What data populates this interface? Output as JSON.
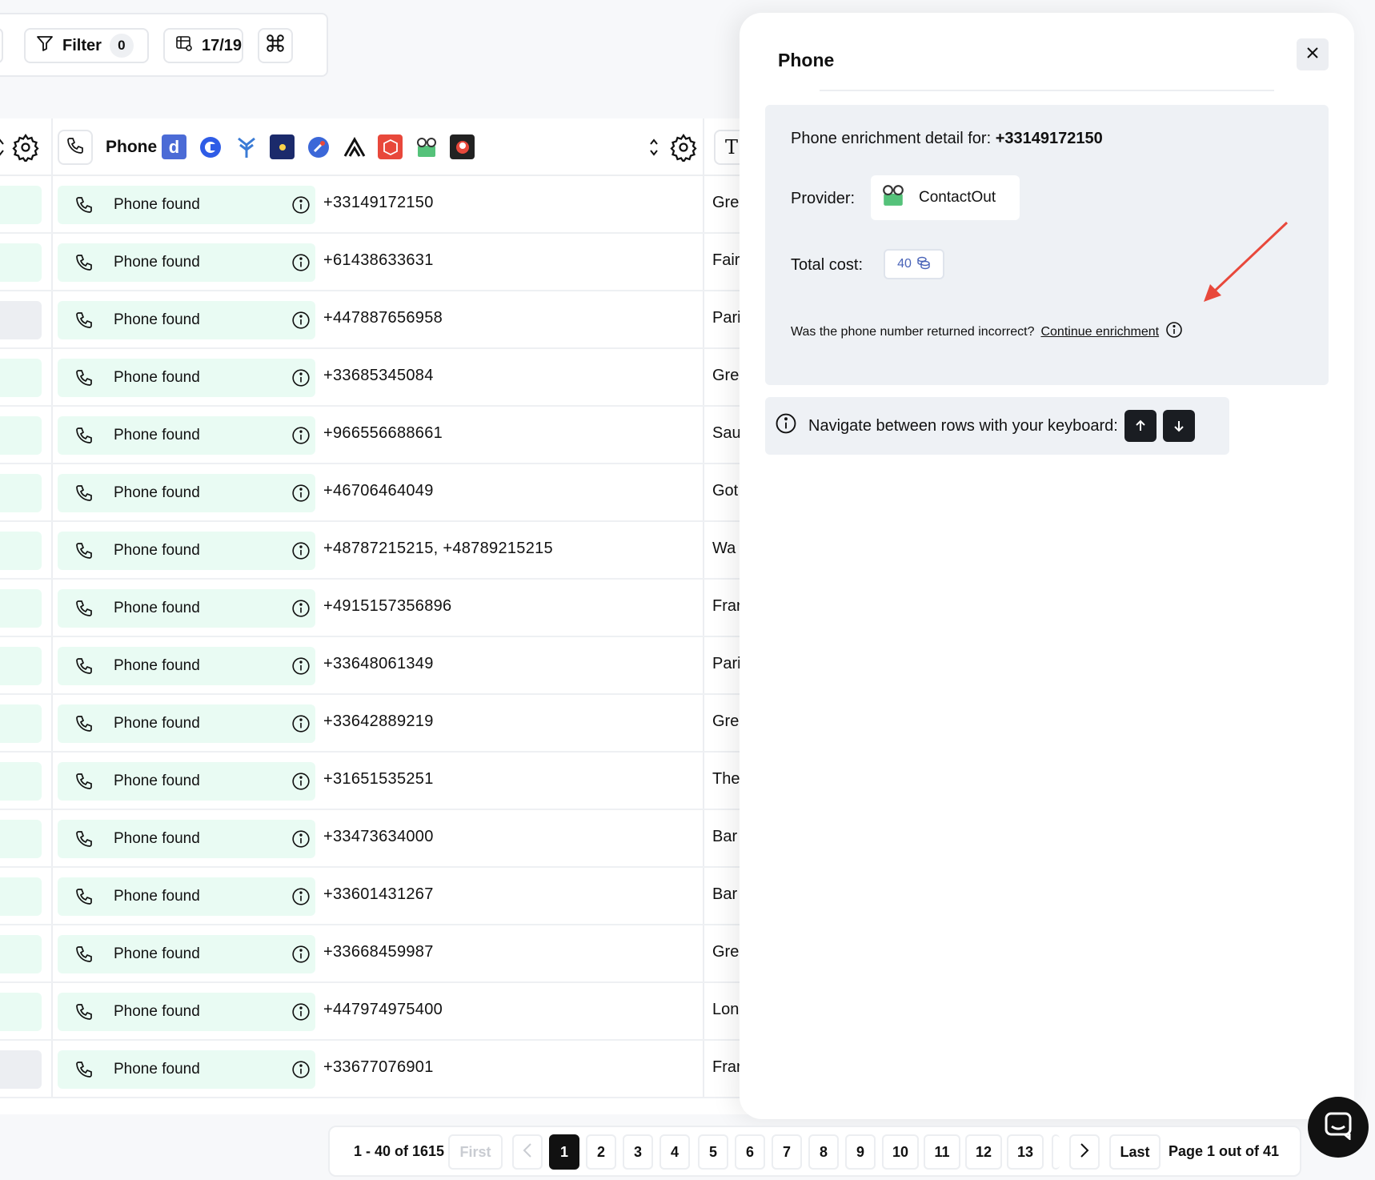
{
  "toolbar": {
    "filter_label": "Filter",
    "filter_count": "0",
    "columns_label": "17/19"
  },
  "table": {
    "phone_column_title": "Phone",
    "next_column_icon": "T",
    "status_label": "Phone found",
    "rows": [
      {
        "phone": "+33149172150",
        "next": "Gre",
        "prev_gray": false
      },
      {
        "phone": "+61438633631",
        "next": "Fair",
        "prev_gray": false
      },
      {
        "phone": "+447887656958",
        "next": "Pari",
        "prev_gray": true
      },
      {
        "phone": "+33685345084",
        "next": "Gre",
        "prev_gray": false
      },
      {
        "phone": "+966556688661",
        "next": "Sau",
        "prev_gray": false
      },
      {
        "phone": "+46706464049",
        "next": "Got",
        "prev_gray": false
      },
      {
        "phone": "+48787215215, +48789215215",
        "next": "Wa",
        "prev_gray": false
      },
      {
        "phone": "+4915157356896",
        "next": "Frar",
        "prev_gray": false
      },
      {
        "phone": "+33648061349",
        "next": "Pari",
        "prev_gray": false
      },
      {
        "phone": "+33642889219",
        "next": "Gre",
        "prev_gray": false
      },
      {
        "phone": "+31651535251",
        "next": "The",
        "prev_gray": false
      },
      {
        "phone": "+33473634000",
        "next": "Bar",
        "prev_gray": false
      },
      {
        "phone": "+33601431267",
        "next": "Bar",
        "prev_gray": false
      },
      {
        "phone": "+33668459987",
        "next": "Gre",
        "prev_gray": false
      },
      {
        "phone": "+447974975400",
        "next": "Lon",
        "prev_gray": false
      },
      {
        "phone": "+33677076901",
        "next": "Frar",
        "prev_gray": true
      }
    ]
  },
  "panel": {
    "title": "Phone",
    "detail_prefix": "Phone enrichment detail for: ",
    "detail_phone": "+33149172150",
    "provider_label": "Provider:",
    "provider_name": "ContactOut",
    "cost_label": "Total cost:",
    "cost_value": "40",
    "incorrect_question": "Was the phone number returned incorrect?",
    "continue_link": "Continue enrichment",
    "keyboard_hint": "Navigate between rows with your keyboard:"
  },
  "pagination": {
    "range": "1 - 40 of 1615",
    "first": "First",
    "pages": [
      "1",
      "2",
      "3",
      "4",
      "5",
      "6",
      "7",
      "8",
      "9",
      "10",
      "11",
      "12",
      "13"
    ],
    "active_page": "1",
    "last": "Last",
    "page_info": "Page 1 out of 41"
  },
  "colors": {
    "found_green": "#e9fbf3",
    "accent_red": "#e8483b",
    "dark": "#111111"
  }
}
